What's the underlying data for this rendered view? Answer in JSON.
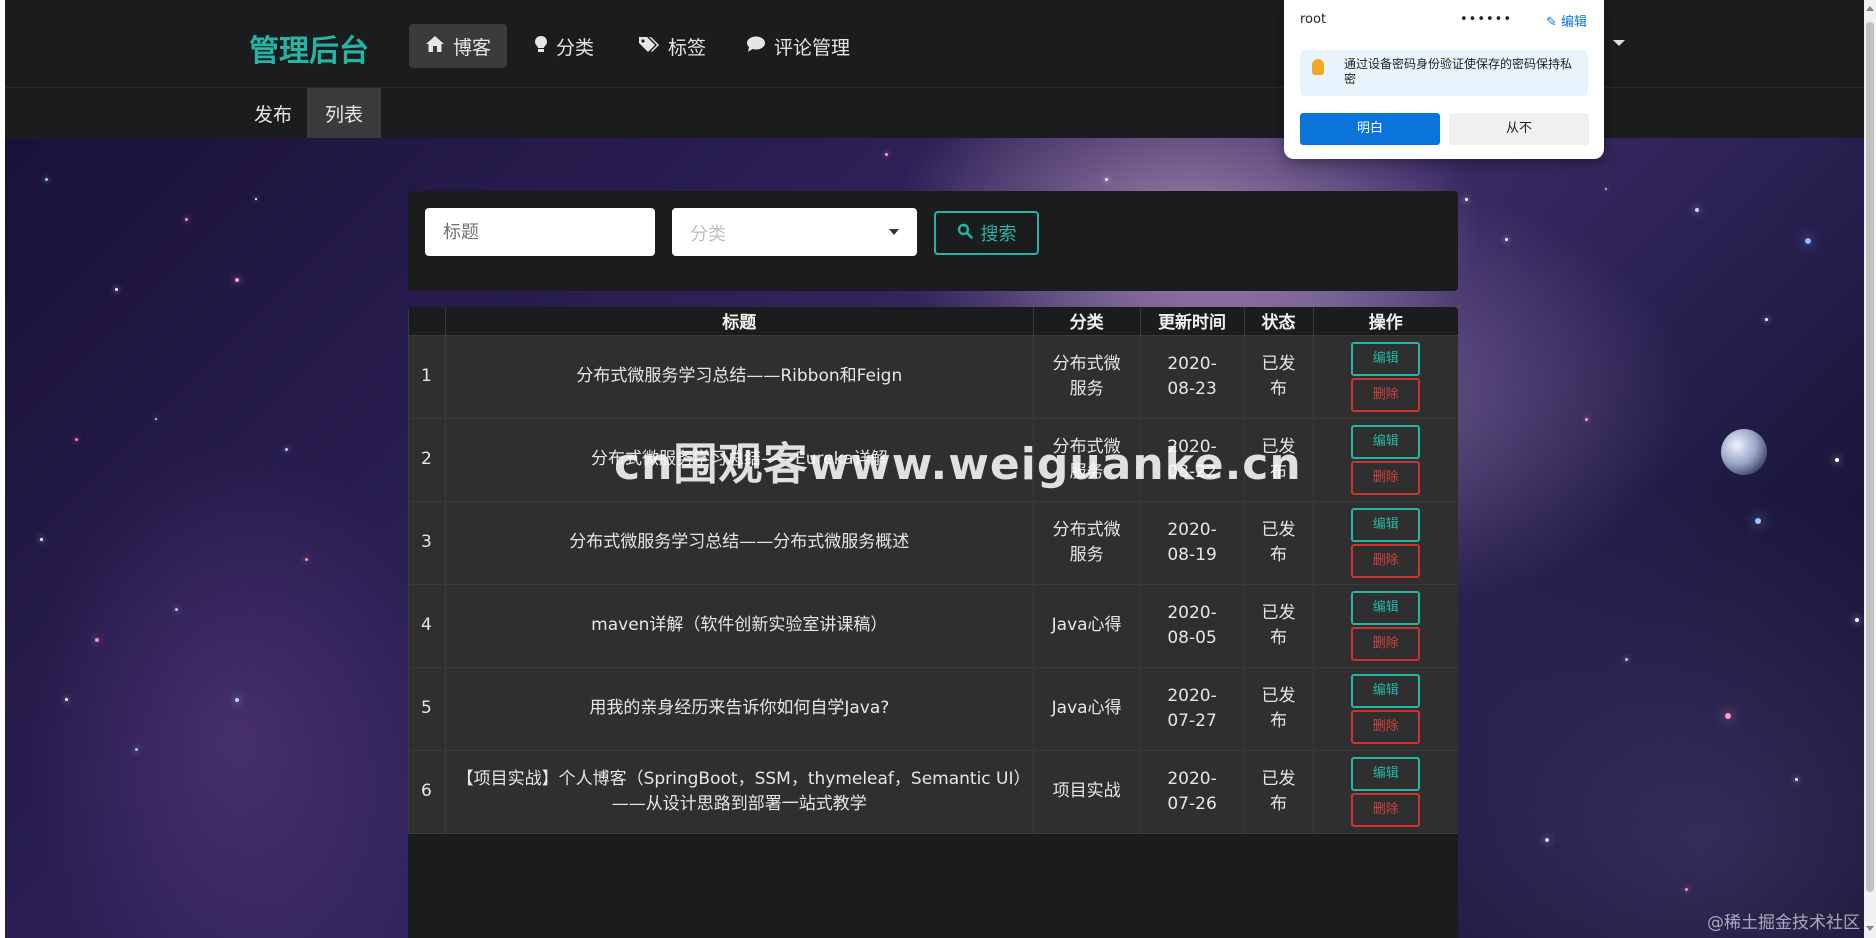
{
  "header": {
    "brand": "管理后台",
    "nav": [
      {
        "label": "博客",
        "icon": "home-icon",
        "active": true
      },
      {
        "label": "分类",
        "icon": "lightbulb-icon",
        "active": false
      },
      {
        "label": "标签",
        "icon": "tags-icon",
        "active": false
      },
      {
        "label": "评论管理",
        "icon": "comment-icon",
        "active": false
      }
    ]
  },
  "subnav": [
    {
      "label": "发布",
      "active": false
    },
    {
      "label": "列表",
      "active": true
    }
  ],
  "search": {
    "title_placeholder": "标题",
    "category_placeholder": "分类",
    "button_label": "搜索"
  },
  "table": {
    "columns": [
      "",
      "标题",
      "分类",
      "更新时间",
      "状态",
      "操作"
    ],
    "rows": [
      {
        "no": "1",
        "title": "分布式微服务学习总结——Ribbon和Feign",
        "category": "分布式微服务",
        "updated": "2020-08-23",
        "status": "已发布"
      },
      {
        "no": "2",
        "title": "分布式微服务学习总结——Eureka详解",
        "category": "分布式微服务",
        "updated": "2020-08-22",
        "status": "已发布"
      },
      {
        "no": "3",
        "title": "分布式微服务学习总结——分布式微服务概述",
        "category": "分布式微服务",
        "updated": "2020-08-19",
        "status": "已发布"
      },
      {
        "no": "4",
        "title": "maven详解（软件创新实验室讲课稿）",
        "category": "Java心得",
        "updated": "2020-08-05",
        "status": "已发布"
      },
      {
        "no": "5",
        "title": "用我的亲身经历来告诉你如何自学Java?",
        "category": "Java心得",
        "updated": "2020-07-27",
        "status": "已发布"
      },
      {
        "no": "6",
        "title": "【项目实战】个人博客（SpringBoot，SSM，thymeleaf，Semantic UI）——从设计思路到部署一站式教学",
        "category": "项目实战",
        "updated": "2020-07-26",
        "status": "已发布"
      }
    ],
    "edit_label": "编辑",
    "delete_label": "删除"
  },
  "password_popup": {
    "username": "root",
    "password_mask": "••••••",
    "edit_label": "编辑",
    "message": "通过设备密码身份验证使保存的密码保持私密",
    "ok_label": "明白",
    "never_label": "从不"
  },
  "watermark": "cn围观客www.weiguanke.cn",
  "corner_watermark": "@稀土掘金技术社区",
  "colors": {
    "brand": "#26b5a4",
    "accent": "#26b5a4",
    "danger": "#d04040",
    "primary_blue": "#0a74d8"
  }
}
